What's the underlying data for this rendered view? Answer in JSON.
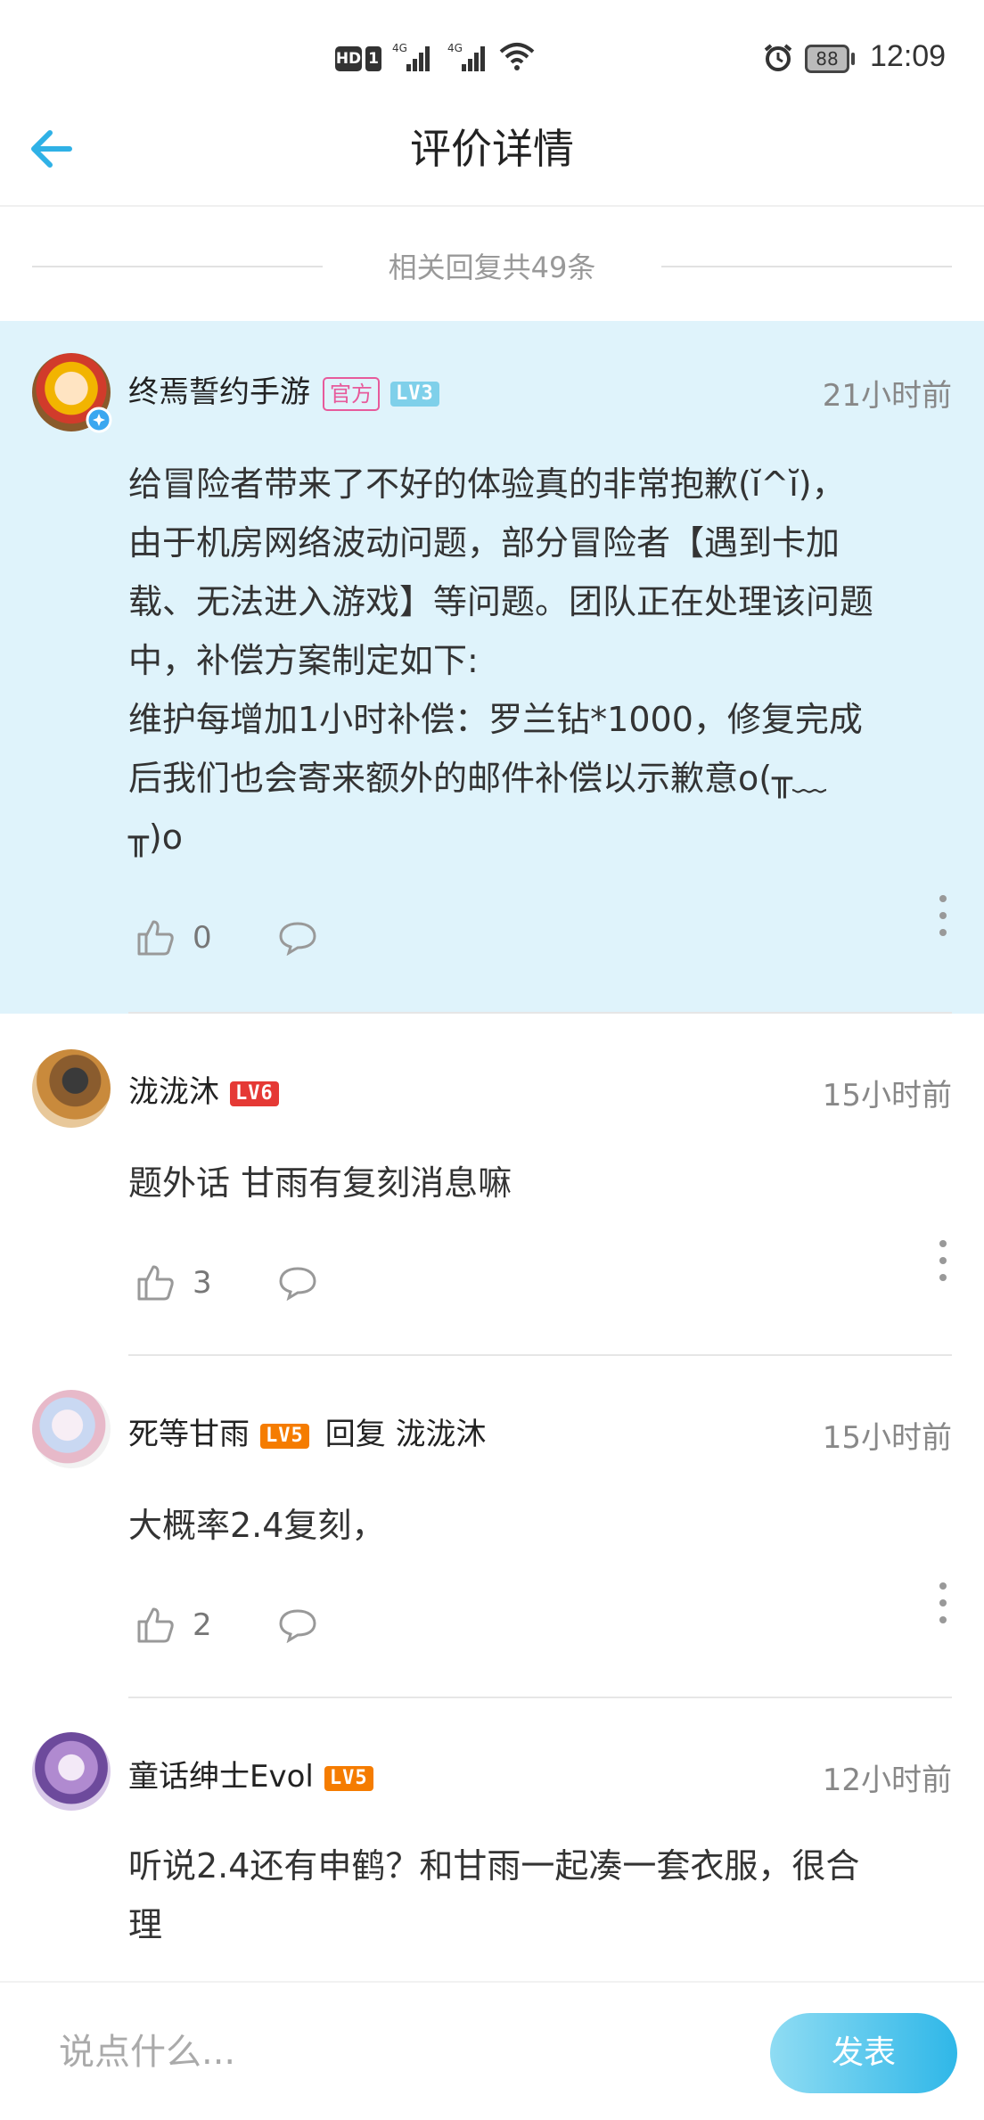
{
  "status_bar": {
    "hd_label": "HD",
    "sim_label": "1",
    "signal1_label": "4G",
    "signal2_label": "4G",
    "battery": "88",
    "time": "12:09"
  },
  "header": {
    "title": "评价详情"
  },
  "replies_summary": "相关回复共49条",
  "comments": [
    {
      "username": "终焉誓约手游",
      "official_badge": "官方",
      "level": "LV3",
      "level_color": "#7fd0ea",
      "time": "21小时前",
      "text_lines": [
        "给冒险者带来了不好的体验真的非常抱歉(ĭ^ĭ)，",
        "由于机房网络波动问题，部分冒险者【遇到卡加",
        "载、无法进入游戏】等问题。团队正在处理该问题",
        "中，补偿方案制定如下:",
        "维护每增加1小时补偿：罗兰钻*1000，修复完成",
        "后我们也会寄来额外的邮件补偿以示歉意o(╥﹏",
        "╥)o"
      ],
      "likes": "0"
    },
    {
      "username": "泷泷沐",
      "level": "LV6",
      "level_color": "#e53935",
      "time": "15小时前",
      "text_lines": [
        "题外话  甘雨有复刻消息嘛"
      ],
      "likes": "3"
    },
    {
      "username": "死等甘雨",
      "level": "LV5",
      "level_color": "#f57c00",
      "reply_word": "回复",
      "reply_to": "泷泷沐",
      "time": "15小时前",
      "text_lines": [
        "大概率2.4复刻，"
      ],
      "likes": "2"
    },
    {
      "username": "童话绅士Evol",
      "level": "LV5",
      "level_color": "#f57c00",
      "time": "12小时前",
      "text_lines": [
        "听说2.4还有申鹤？和甘雨一起凑一套衣服，很合",
        "理"
      ]
    }
  ],
  "input": {
    "placeholder": "说点什么...",
    "send_label": "发表"
  },
  "colors": {
    "accent": "#2fb1e6",
    "highlight_bg": "#dff3fb"
  }
}
